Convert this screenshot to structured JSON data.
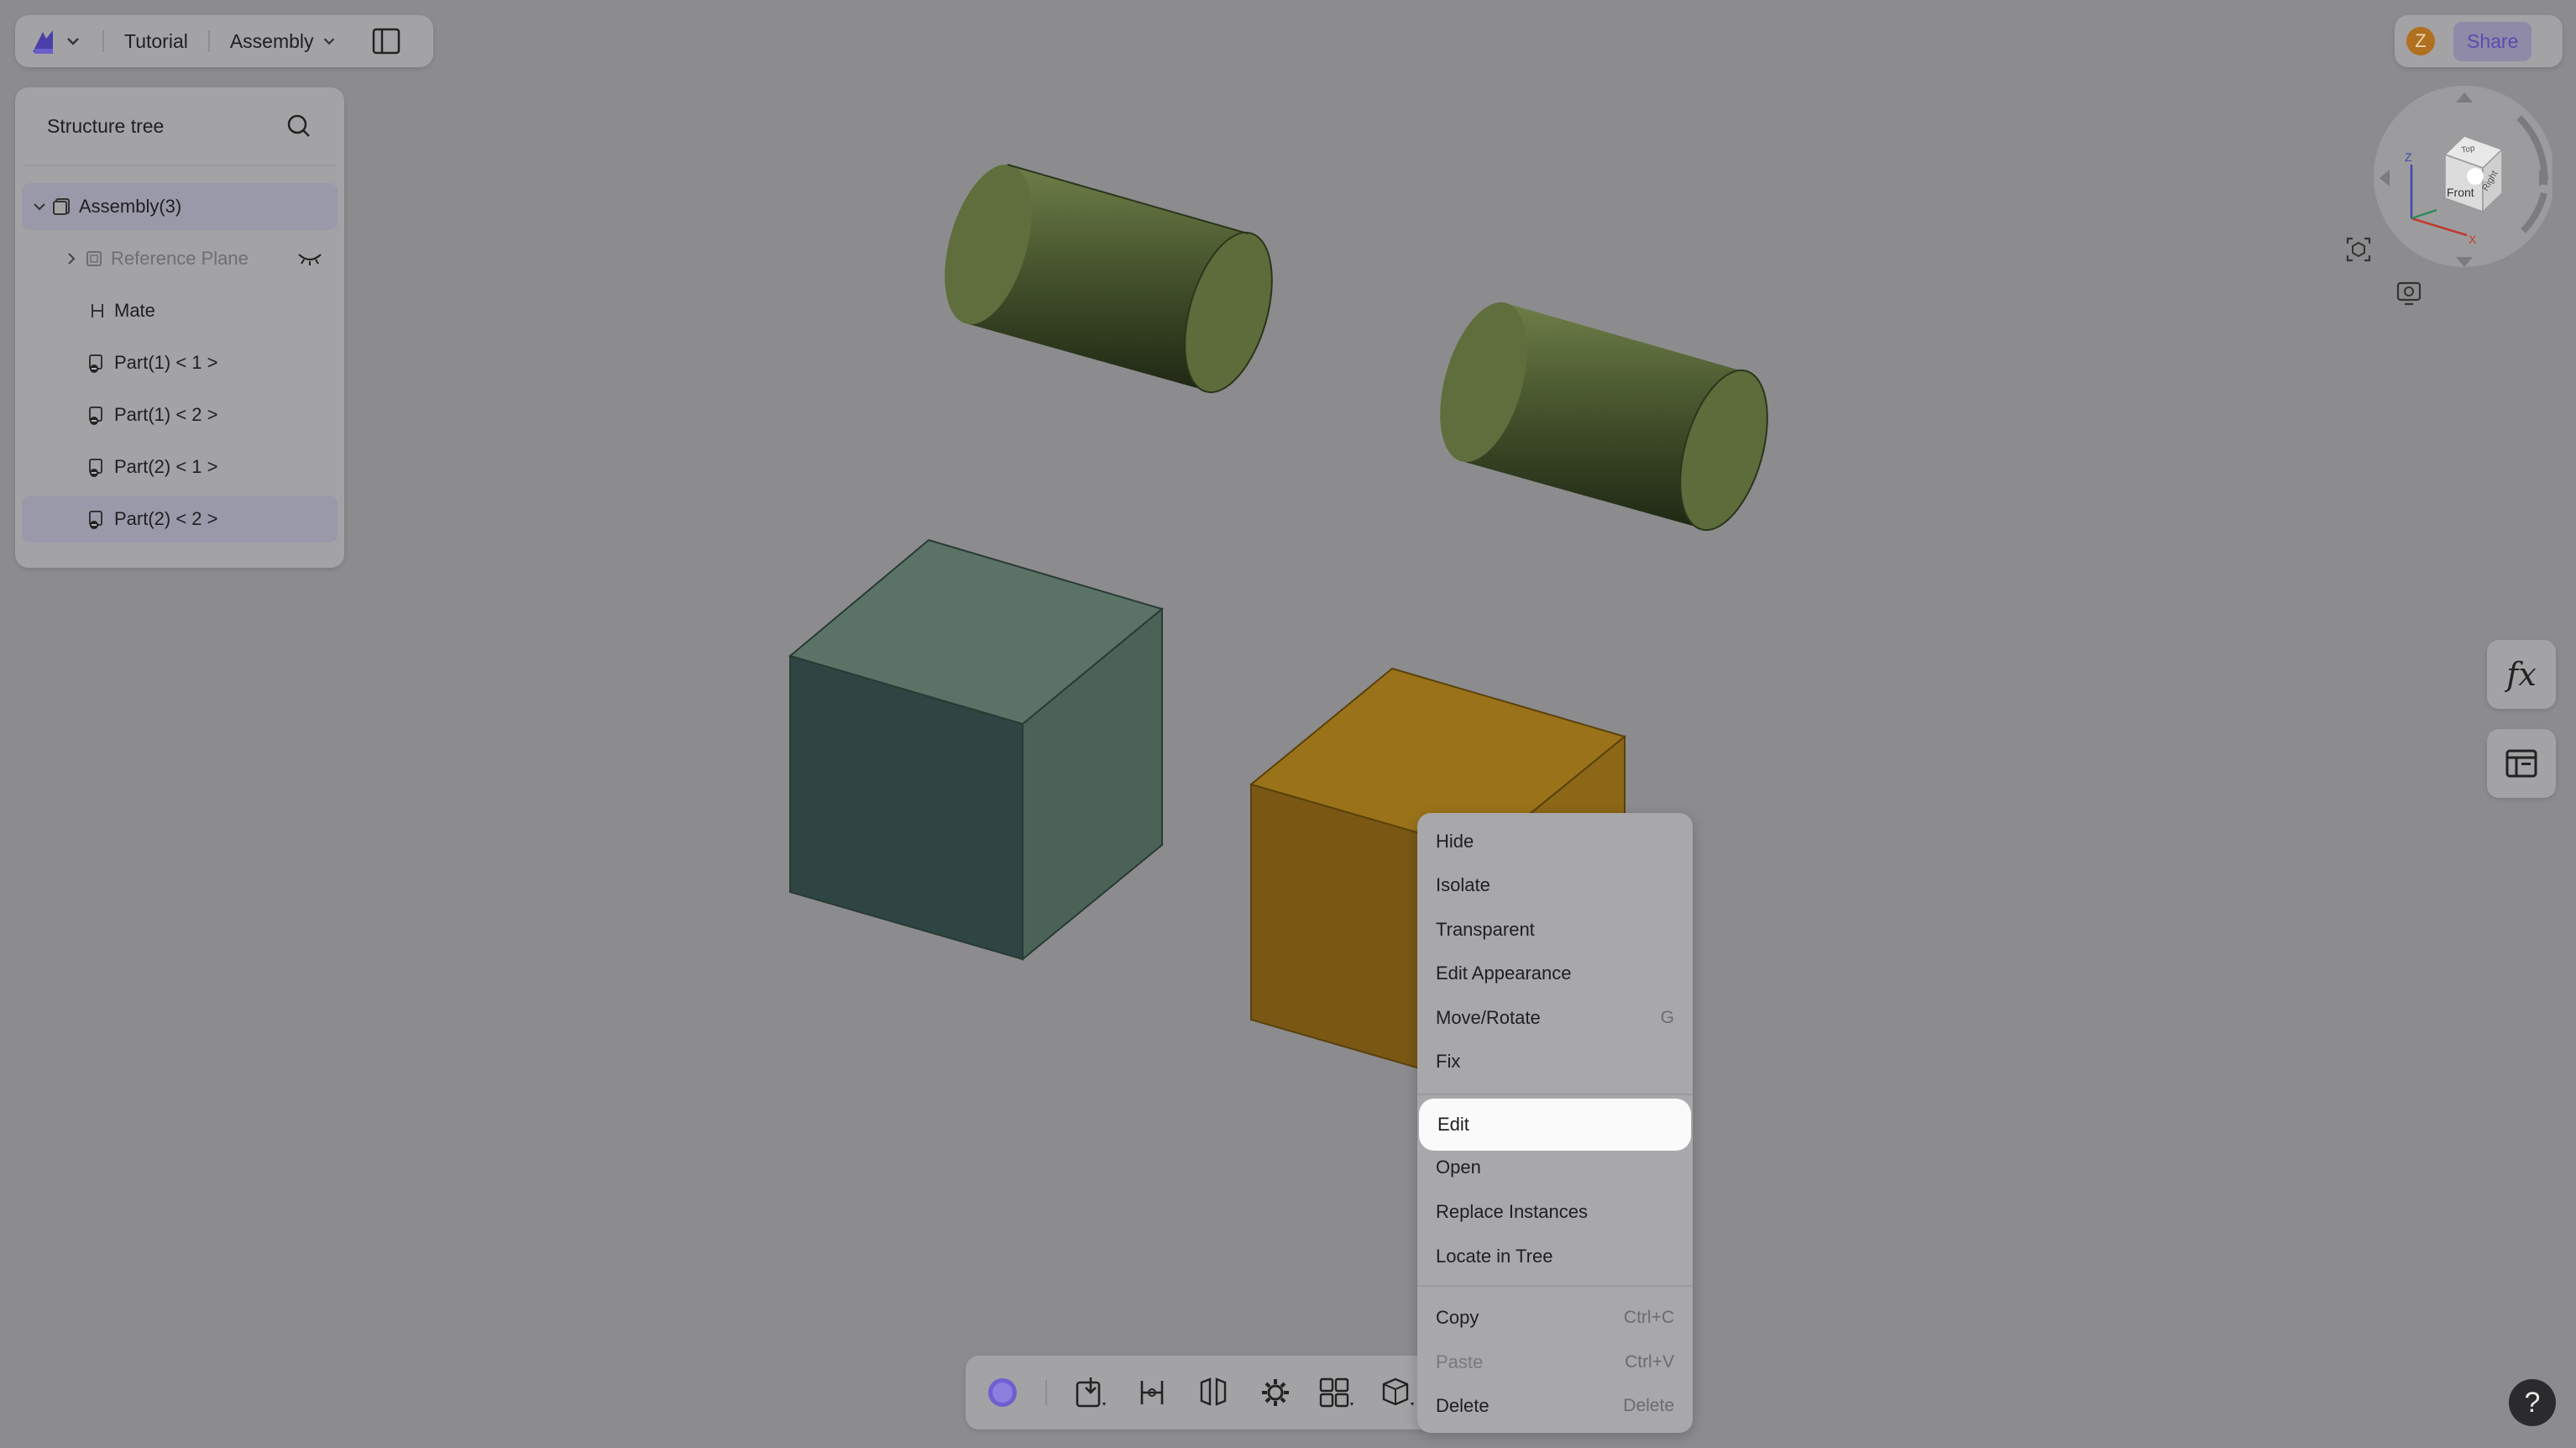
{
  "topbar": {
    "logo_icon": "dz-logo-icon",
    "project": "Tutorial",
    "mode": "Assembly"
  },
  "share": {
    "avatar_letter": "Z",
    "share_label": "Share"
  },
  "tree": {
    "title": "Structure tree",
    "items": [
      {
        "label": "Assembly(3)"
      },
      {
        "label": "Reference Plane"
      },
      {
        "label": "Mate"
      },
      {
        "label": "Part(1) < 1 >"
      },
      {
        "label": "Part(1) < 2 >"
      },
      {
        "label": "Part(2) < 1 >"
      },
      {
        "label": "Part(2) < 2 >"
      }
    ]
  },
  "navcube": {
    "face_front": "Front",
    "face_top": "Top",
    "face_right": "Right",
    "axis_z": "Z",
    "axis_x": "X"
  },
  "side": {
    "fx_label": "fx"
  },
  "menu": {
    "items": [
      {
        "label": "Hide",
        "shortcut": ""
      },
      {
        "label": "Isolate",
        "shortcut": ""
      },
      {
        "label": "Transparent",
        "shortcut": ""
      },
      {
        "label": "Edit Appearance",
        "shortcut": ""
      },
      {
        "label": "Move/Rotate",
        "shortcut": "G"
      },
      {
        "label": "Fix",
        "shortcut": ""
      },
      {
        "label": "Edit",
        "shortcut": ""
      },
      {
        "label": "Open",
        "shortcut": ""
      },
      {
        "label": "Replace Instances",
        "shortcut": ""
      },
      {
        "label": "Locate in Tree",
        "shortcut": ""
      },
      {
        "label": "Copy",
        "shortcut": "Ctrl+C"
      },
      {
        "label": "Paste",
        "shortcut": "Ctrl+V"
      },
      {
        "label": "Delete",
        "shortcut": "Delete"
      }
    ]
  },
  "help_label": "?",
  "colors": {
    "background": "#8c8c8e",
    "cylinder": "#5b6b3a",
    "cube_gray": "#3f5a52",
    "cube_orange": "#8a6416",
    "accent": "#5a4bb0"
  }
}
